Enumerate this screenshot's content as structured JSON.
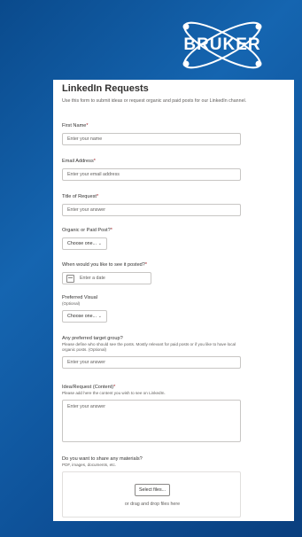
{
  "brand": {
    "logo_text": "BRUKER"
  },
  "form": {
    "title": "LinkedIn Requests",
    "description": "Use this form to submit ideas or request organic and paid posts for our LinkedIn channel.",
    "questions": [
      {
        "label": "First Name",
        "required": "*",
        "placeholder": "Enter your name"
      },
      {
        "label": "Email Address",
        "required": "*",
        "placeholder": "Enter your email address"
      },
      {
        "label": "Title of Request",
        "required": "*",
        "placeholder": "Enter your answer"
      },
      {
        "label": "Organic or Paid Post?",
        "required": "*",
        "value": "Choose one...",
        "chevron": "⌄"
      },
      {
        "label": "When would you like to see it posted?",
        "required": "*",
        "placeholder": "Enter a date"
      },
      {
        "label": "Preferred Visual",
        "sub": "(Optional)",
        "value": "Choose one...",
        "chevron": "⌄"
      },
      {
        "label": "Any preferred target group?",
        "sub": "Please define who should see the posts. Mostly relevant for paid posts or if you like to have local organic  posts. (Optional)",
        "placeholder": "Enter your answer"
      },
      {
        "label": "Idea/Request (Content)",
        "required": "*",
        "sub": "Please add here the content you wish to see on LinkedIn.",
        "placeholder": "Enter your answer"
      },
      {
        "label": "Do you want to share any materials?",
        "sub": "PDF, images, documents, etc.",
        "button": "Select files...",
        "hint": "or drag and drop files here"
      }
    ]
  }
}
